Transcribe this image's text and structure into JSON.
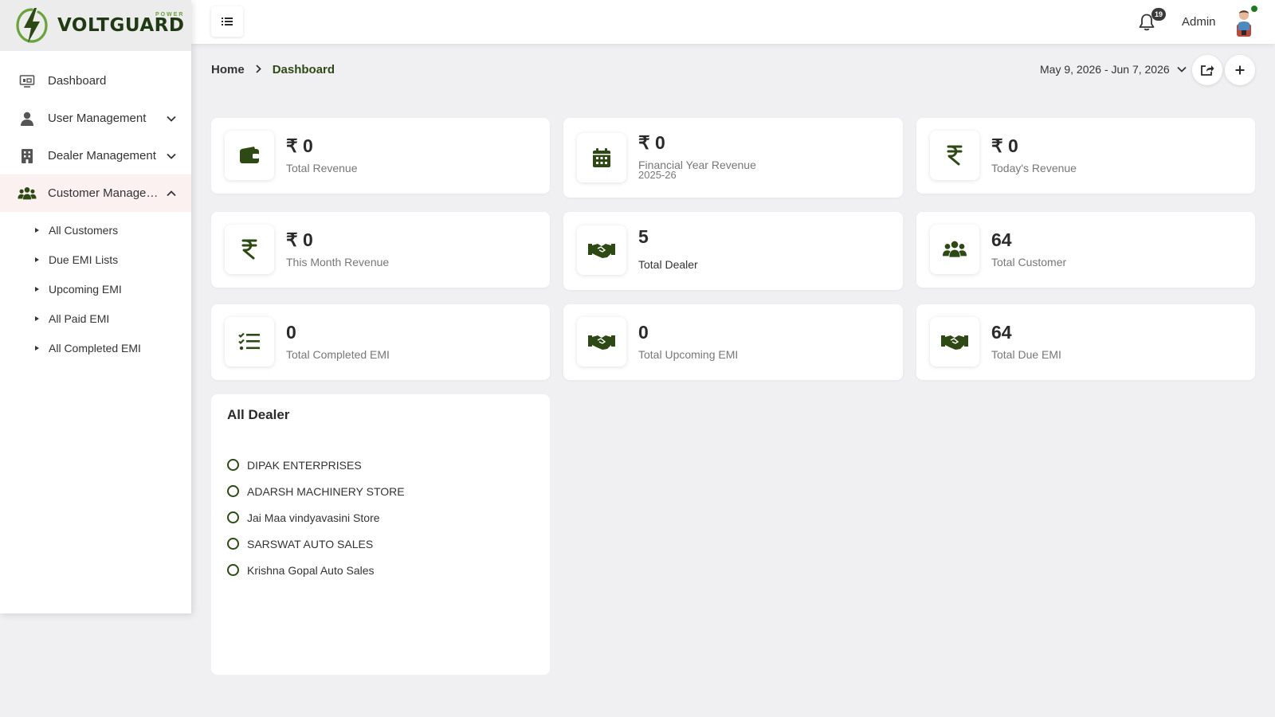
{
  "brand": {
    "name": "VOLTGUARD",
    "tagline": "POWER",
    "color": "#2e4a14"
  },
  "sidebar": {
    "items": [
      {
        "label": "Dashboard",
        "icon": "dashboard-icon",
        "expandable": false
      },
      {
        "label": "User Management",
        "icon": "user-icon",
        "expandable": true,
        "expanded": false
      },
      {
        "label": "Dealer Management",
        "icon": "building-icon",
        "expandable": true,
        "expanded": false
      },
      {
        "label": "Customer Management",
        "icon": "users-icon",
        "expandable": true,
        "expanded": true,
        "active": true
      }
    ],
    "sub_items": [
      "All Customers",
      "Due EMI Lists",
      "Upcoming EMI",
      "All Paid EMI",
      "All Completed EMI"
    ]
  },
  "topbar": {
    "notifications": "19",
    "user_name": "Admin"
  },
  "breadcrumb": {
    "home": "Home",
    "current": "Dashboard"
  },
  "date_range": "May 9, 2026 - Jun 7, 2026",
  "stats": [
    {
      "value": "₹ 0",
      "label": "Total Revenue",
      "icon": "wallet-icon"
    },
    {
      "value": "₹ 0",
      "label": "Financial Year Revenue",
      "sublabel": "2025-26",
      "icon": "calendar-icon"
    },
    {
      "value": "₹ 0",
      "label": "Today's Revenue",
      "icon": "rupee-icon"
    },
    {
      "value": "₹ 0",
      "label": "This Month Revenue",
      "icon": "rupee-icon"
    },
    {
      "value": "5",
      "label": "Total Dealer",
      "icon": "handshake-icon"
    },
    {
      "value": "64",
      "label": "Total Customer",
      "icon": "users-icon"
    },
    {
      "value": "0",
      "label": "Total Completed EMI",
      "icon": "checklist-icon"
    },
    {
      "value": "0",
      "label": "Total Upcoming EMI",
      "icon": "handshake-icon"
    },
    {
      "value": "64",
      "label": "Total Due EMI",
      "icon": "handshake-icon"
    }
  ],
  "dealers": {
    "title": "All Dealer",
    "items": [
      "DIPAK ENTERPRISES",
      "ADARSH MACHINERY STORE",
      "Jai Maa vindyavasini Store",
      "SARSWAT AUTO SALES",
      "Krishna Gopal Auto Sales"
    ]
  }
}
